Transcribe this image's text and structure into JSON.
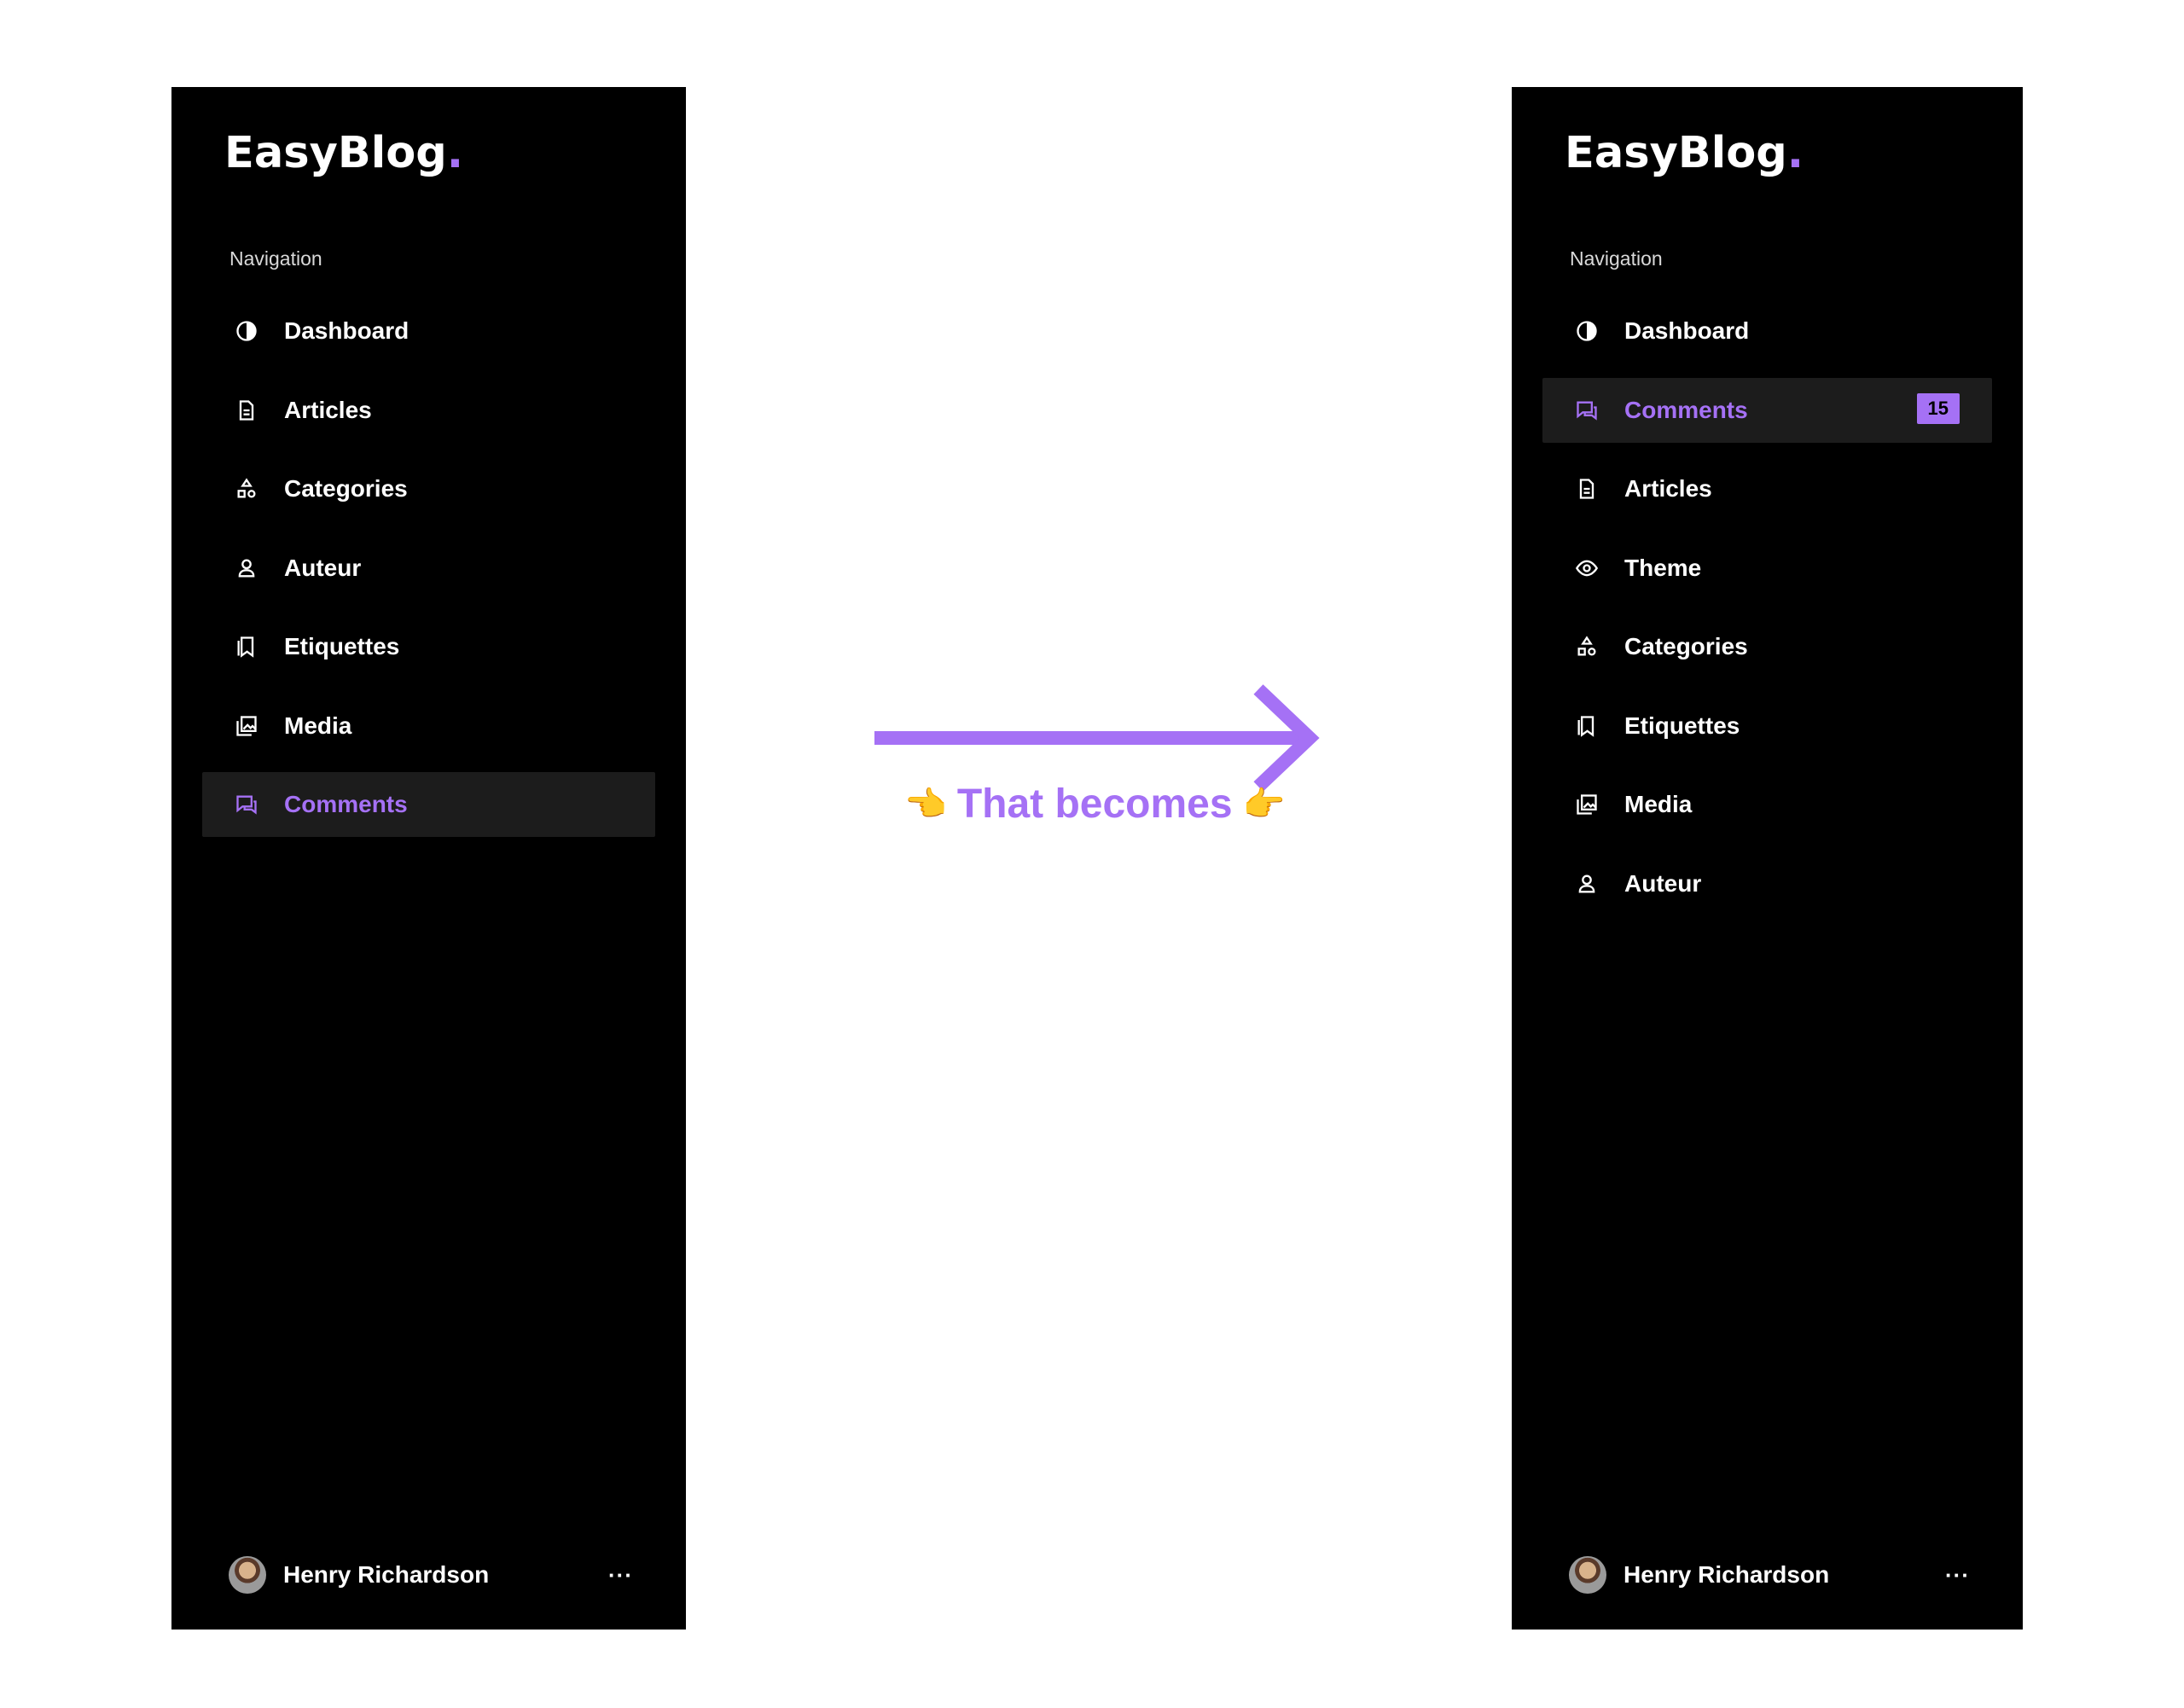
{
  "brand": {
    "name": "EasyBlog",
    "dot": "."
  },
  "accent_color": "#a571f5",
  "caption": {
    "text": "That becomes",
    "left_emoji": "👈",
    "right_emoji": "👉"
  },
  "before": {
    "nav_label": "Navigation",
    "items": [
      {
        "label": "Dashboard",
        "icon": "dashboard-icon"
      },
      {
        "label": "Articles",
        "icon": "document-icon"
      },
      {
        "label": "Categories",
        "icon": "shapes-icon"
      },
      {
        "label": "Auteur",
        "icon": "user-icon"
      },
      {
        "label": "Etiquettes",
        "icon": "bookmark-icon"
      },
      {
        "label": "Media",
        "icon": "image-icon"
      },
      {
        "label": "Comments",
        "icon": "comments-icon",
        "active": true
      }
    ],
    "user": {
      "name": "Henry Richardson",
      "more": "···"
    }
  },
  "after": {
    "nav_label": "Navigation",
    "items": [
      {
        "label": "Dashboard",
        "icon": "dashboard-icon"
      },
      {
        "label": "Comments",
        "icon": "comments-icon",
        "active": true,
        "badge": "15"
      },
      {
        "label": "Articles",
        "icon": "document-icon"
      },
      {
        "label": "Theme",
        "icon": "eye-icon"
      },
      {
        "label": "Categories",
        "icon": "shapes-icon"
      },
      {
        "label": "Etiquettes",
        "icon": "bookmark-icon"
      },
      {
        "label": "Media",
        "icon": "image-icon"
      },
      {
        "label": "Auteur",
        "icon": "user-icon"
      }
    ],
    "user": {
      "name": "Henry Richardson",
      "more": "···"
    }
  }
}
